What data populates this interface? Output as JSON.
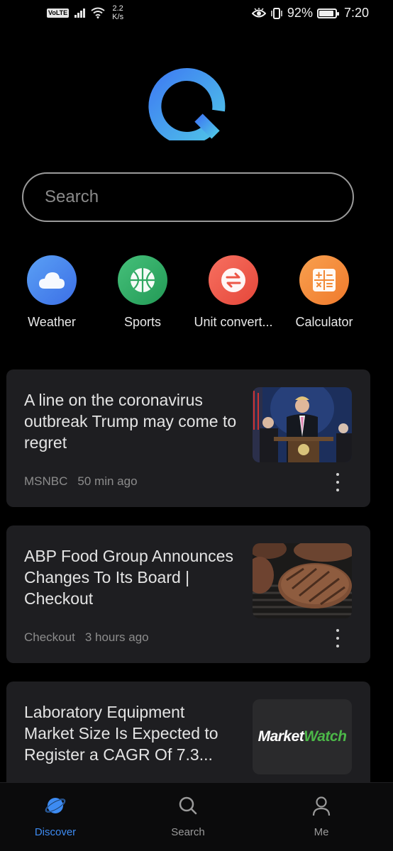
{
  "status_bar": {
    "volte": "VoLTE",
    "speed_value": "2.2",
    "speed_unit": "K/s",
    "battery": "92%",
    "battery_level": 0.92,
    "time": "7:20"
  },
  "search": {
    "placeholder": "Search"
  },
  "shortcuts": [
    {
      "label": "Weather",
      "icon": "cloud-icon",
      "color": "#4a8ef0"
    },
    {
      "label": "Sports",
      "icon": "basketball-icon",
      "color": "#2fb067"
    },
    {
      "label": "Unit convert...",
      "icon": "convert-arrows-icon",
      "color": "#ee5b4b"
    },
    {
      "label": "Calculator",
      "icon": "calculator-icon",
      "color": "#f48d3b"
    }
  ],
  "news": [
    {
      "headline": "A line on the coronavirus outbreak Trump may come to regret",
      "source": "MSNBC",
      "time": "50 min ago",
      "image": "press-briefing-photo"
    },
    {
      "headline": "ABP Food Group Announces Changes To Its Board | Checkout",
      "source": "Checkout",
      "time": "3 hours ago",
      "image": "burger-patties-photo"
    },
    {
      "headline": "Laboratory Equipment Market Size Is Expected to Register a CAGR Of 7.3...",
      "source": "",
      "time": "",
      "image": "marketwatch-logo",
      "image_text_1": "Market",
      "image_text_2": "Watch"
    }
  ],
  "bottom_nav": [
    {
      "label": "Discover",
      "icon": "planet-icon",
      "active": true
    },
    {
      "label": "Search",
      "icon": "search-icon",
      "active": false
    },
    {
      "label": "Me",
      "icon": "person-icon",
      "active": false
    }
  ],
  "colors": {
    "accent": "#3d8bf2",
    "card_bg": "#1e1e21",
    "background": "#000000"
  }
}
